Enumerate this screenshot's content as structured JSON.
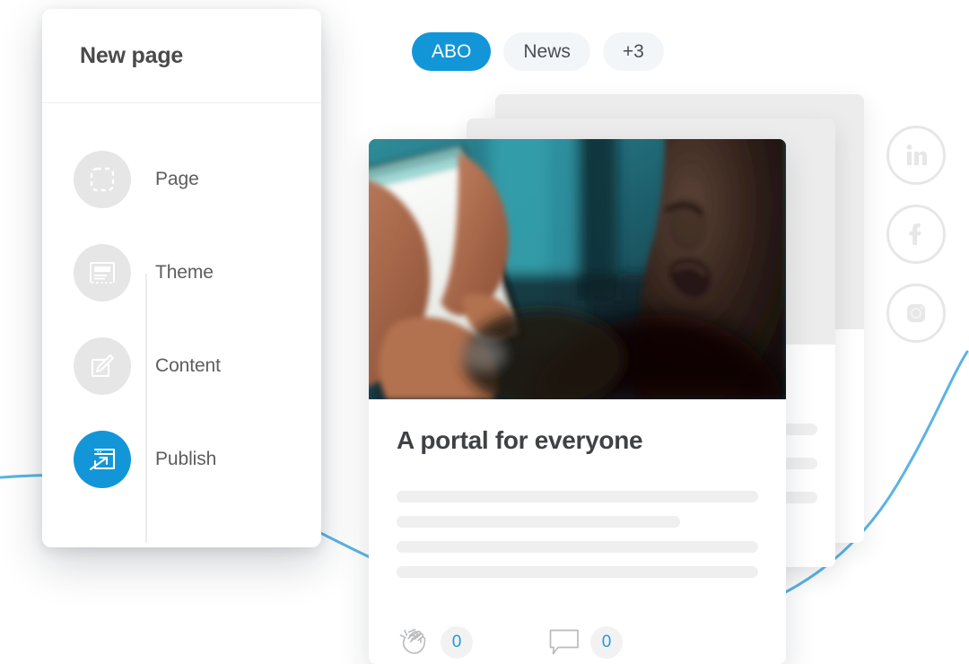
{
  "wizard": {
    "title": "New page",
    "steps": [
      {
        "label": "Page",
        "icon": "dashed-frame-icon",
        "state": "inactive"
      },
      {
        "label": "Theme",
        "icon": "layout-template-icon",
        "state": "inactive"
      },
      {
        "label": "Content",
        "icon": "pencil-edit-icon",
        "state": "inactive"
      },
      {
        "label": "Publish",
        "icon": "publish-window-icon",
        "state": "active"
      }
    ]
  },
  "tags": [
    {
      "label": "ABO",
      "state": "active"
    },
    {
      "label": "News",
      "state": "inactive"
    },
    {
      "label": "+3",
      "state": "inactive"
    }
  ],
  "article_card": {
    "title": "A portal for everyone",
    "image_alt": "person holding a smartphone with a blank white screen",
    "body_placeholder_lines": 4,
    "actions": [
      {
        "icon": "clap-hands-icon",
        "count": "0"
      },
      {
        "icon": "comment-bubble-icon",
        "count": "0"
      }
    ]
  },
  "stacked_cards": {
    "middle_placeholder_lines": 3,
    "back_placeholder_lines": 0
  },
  "social": [
    {
      "icon": "linkedin-icon",
      "label": "in"
    },
    {
      "icon": "facebook-icon",
      "label": "f"
    },
    {
      "icon": "instagram-icon",
      "label": ""
    }
  ],
  "colors": {
    "accent_blue": "#1296d8",
    "count_blue": "#1e9ae0",
    "curve_blue": "#5ab4e5",
    "text_dark": "#4a4a4a",
    "placeholder_gray": "#efefef",
    "pill_bg": "#f3f6f8"
  }
}
